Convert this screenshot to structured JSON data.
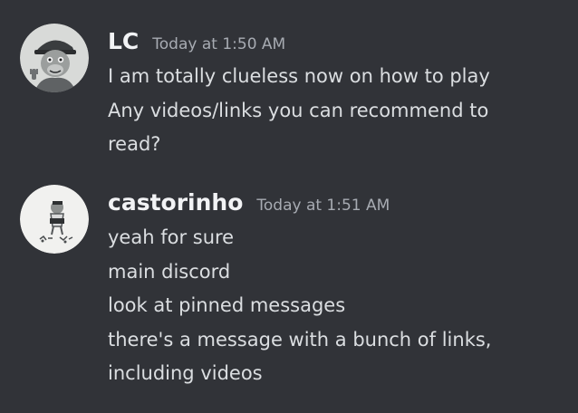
{
  "messages": [
    {
      "avatar_icon": "ape-avatar-icon",
      "username": "LC",
      "timestamp": "Today at 1:50 AM",
      "lines": [
        "I am totally clueless now on how to play",
        "Any videos/links you can recommend to",
        "read?"
      ]
    },
    {
      "avatar_icon": "sketch-avatar-icon",
      "username": "castorinho",
      "timestamp": "Today at 1:51 AM",
      "lines": [
        "yeah for sure",
        "main discord",
        "look at pinned messages",
        "there's a message with a bunch of links,",
        "including videos"
      ]
    }
  ],
  "colors": {
    "background": "#313338",
    "username": "#f2f3f5",
    "timestamp": "#a7abb2",
    "text": "#dbdee1"
  }
}
